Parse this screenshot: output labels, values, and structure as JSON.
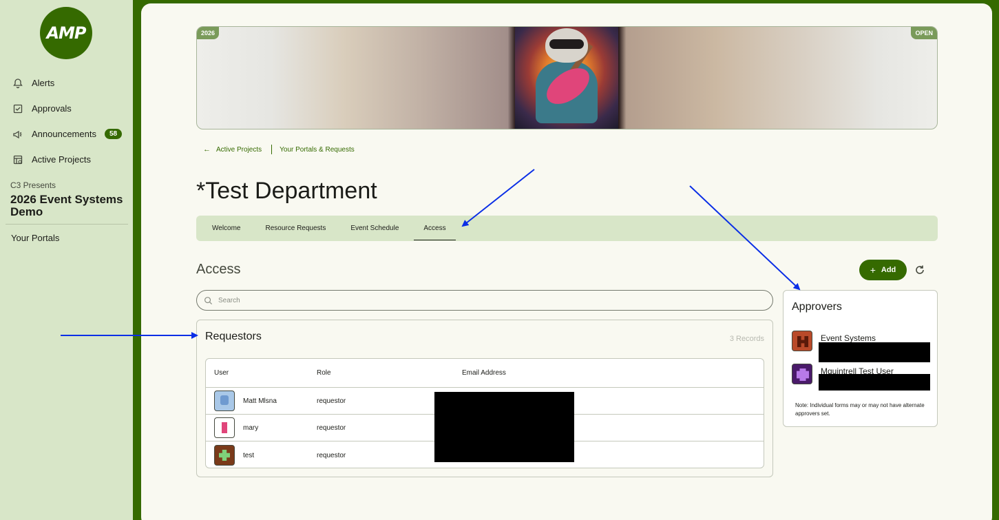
{
  "sidebar": {
    "logo_text": "AMP",
    "nav": [
      {
        "label": "Alerts",
        "icon": "bell-icon"
      },
      {
        "label": "Approvals",
        "icon": "checkbox-icon"
      },
      {
        "label": "Announcements",
        "icon": "megaphone-icon",
        "badge": "58"
      },
      {
        "label": "Active Projects",
        "icon": "project-list-icon"
      }
    ],
    "presents": "C3 Presents",
    "event_title": "2026 Event Systems Demo",
    "your_portals": "Your Portals"
  },
  "banner": {
    "year_tag": "2026",
    "status_tag": "OPEN"
  },
  "breadcrumb": {
    "back_label": "Active Projects",
    "current_label": "Your Portals & Requests"
  },
  "page": {
    "title": "*Test Department"
  },
  "tabs": [
    {
      "label": "Welcome",
      "active": false
    },
    {
      "label": "Resource Requests",
      "active": false
    },
    {
      "label": "Event Schedule",
      "active": false
    },
    {
      "label": "Access",
      "active": true
    }
  ],
  "access": {
    "title": "Access",
    "add_label": "Add",
    "search_placeholder": "Search"
  },
  "requestors": {
    "title": "Requestors",
    "record_count": "3 Records",
    "columns": [
      "User",
      "Role",
      "Email Address"
    ],
    "rows": [
      {
        "user": "Matt Mlsna",
        "role": "requestor"
      },
      {
        "user": "mary",
        "role": "requestor"
      },
      {
        "user": "test",
        "role": "requestor"
      }
    ]
  },
  "approvers": {
    "title": "Approvers",
    "items": [
      {
        "name": "Event Systems"
      },
      {
        "name": "Mquintrell Test User"
      }
    ],
    "note": "Note: Individual forms may or may not have alternate approvers set."
  },
  "colors": {
    "brand_green": "#356a00",
    "sidebar_bg": "#d8e6c8",
    "annotation_arrow": "#0a2ee6"
  }
}
